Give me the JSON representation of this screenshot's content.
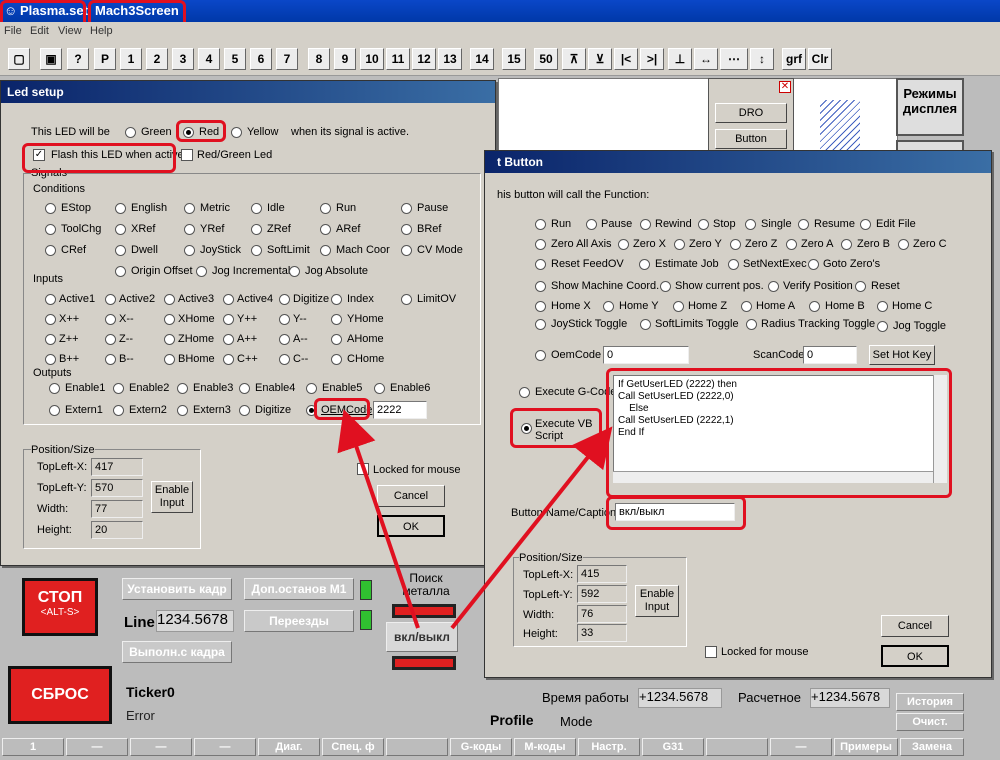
{
  "titlebar": {
    "app": "Plasma.set",
    "screen": "Mach3Screen"
  },
  "menubar": [
    "File",
    "Edit",
    "View",
    "Help"
  ],
  "toolbar": [
    "P",
    "1",
    "2",
    "3",
    "4",
    "5",
    "6",
    "7",
    "8",
    "9",
    "10",
    "11",
    "12",
    "13",
    "14",
    "15",
    "50",
    "grf",
    "Clr"
  ],
  "background": {
    "regimy": "Режимы дисплея",
    "dro_label": "DRO",
    "button_label": "Button",
    "stop": "СТОП",
    "stop_sub": "<ALT-S>",
    "reset": "СБРОС",
    "set_frame": "Установить кадр",
    "run_from": "Выполн.с кадра",
    "m1_stop": "Доп.останов М1",
    "transitions": "Переезды",
    "line_label": "Line",
    "line_value": "1234.5678",
    "search_metal": "Поиск металла",
    "on_off": "вкл/выкл",
    "ticker": "Ticker0",
    "error": "Error",
    "profile": "Profile",
    "mode": "Mode",
    "work_time_label": "Время работы",
    "work_time_value": "+1234.5678",
    "calc_label": "Расчетное",
    "calc_value": "+1234.5678",
    "history": "История",
    "clear": "Очист.",
    "bottom": [
      "1",
      "—",
      "—",
      "—",
      "Диаг.",
      "Спец. ф",
      "",
      "G-коды",
      "М-коды",
      "Настр.",
      "G31",
      "",
      "—",
      "Примеры",
      "Замена"
    ]
  },
  "led_setup": {
    "title": "Led setup",
    "led_will_be": "This LED will be",
    "green": "Green",
    "red": "Red",
    "yellow": "Yellow",
    "when_active": "when its signal is active.",
    "flash": "Flash this LED when active",
    "red_green": "Red/Green Led",
    "signals": "Signals",
    "conditions": "Conditions",
    "cond_rows": [
      [
        "EStop",
        "English",
        "Metric",
        "Idle",
        "Run",
        "Pause"
      ],
      [
        "ToolChg",
        "XRef",
        "YRef",
        "ZRef",
        "ARef",
        "BRef"
      ],
      [
        "CRef",
        "Dwell",
        "JoyStick",
        "SoftLimit",
        "Mach Coor",
        "CV Mode"
      ]
    ],
    "cond_row4": [
      "Origin Offset",
      "Jog Incremental",
      "Jog Absolute"
    ],
    "inputs": "Inputs",
    "input_rows": [
      [
        "Active1",
        "Active2",
        "Active3",
        "Active4",
        "Digitize",
        "Index",
        "LimitOV"
      ],
      [
        "X++",
        "X--",
        "XHome",
        "Y++",
        "Y--",
        "YHome"
      ],
      [
        "Z++",
        "Z--",
        "ZHome",
        "A++",
        "A--",
        "AHome"
      ],
      [
        "B++",
        "B--",
        "BHome",
        "C++",
        "C--",
        "CHome"
      ]
    ],
    "outputs": "Outputs",
    "output_row1": [
      "Enable1",
      "Enable2",
      "Enable3",
      "Enable4",
      "Enable5",
      "Enable6"
    ],
    "output_row2": [
      "Extern1",
      "Extern2",
      "Extern3",
      "Digitize",
      "OEMCode"
    ],
    "oem_value": "2222",
    "position_size": "Position/Size",
    "topleft_x_label": "TopLeft-X:",
    "topleft_x": "417",
    "topleft_y_label": "TopLeft-Y:",
    "topleft_y": "570",
    "width_label": "Width:",
    "width": "77",
    "height_label": "Height:",
    "height": "20",
    "enable_input": "Enable Input",
    "locked": "Locked for mouse",
    "cancel": "Cancel",
    "ok": "OK"
  },
  "button_setup": {
    "title": "t Button",
    "call_fn": "his button will call the Function:",
    "fn_rows": [
      [
        "Run",
        "Pause",
        "Rewind",
        "Stop",
        "Single",
        "Resume",
        "Edit File"
      ],
      [
        "Zero All Axis",
        "Zero X",
        "Zero Y",
        "Zero Z",
        "Zero A",
        "Zero B",
        "Zero C"
      ],
      [
        "Reset FeedOV",
        "Estimate Job",
        "SetNextExec",
        "Goto Zero's"
      ],
      [
        "Show Machine Coord.",
        "Show current pos.",
        "Verify Position",
        "Reset"
      ],
      [
        "Home X",
        "Home Y",
        "Home Z",
        "Home A",
        "Home B",
        "Home C"
      ],
      [
        "JoyStick Toggle",
        "SoftLimits Toggle",
        "Radius Tracking Toggle",
        "Jog Toggle"
      ]
    ],
    "oem_code": "OemCode",
    "oem_value": "0",
    "scan_code": "ScanCode",
    "scan_value": "0",
    "set_hot_key": "Set Hot Key",
    "exec_gcode": "Execute G-Code",
    "exec_vb": "Execute VB Script",
    "vb_script": "If GetUserLED (2222) then\nCall SetUserLED (2222,0)\n    Else\nCall SetUserLED (2222,1)\nEnd If",
    "caption_label": "Button Name/Caption",
    "caption_value": "вкл/выкл",
    "position_size": "Position/Size",
    "topleft_x_label": "TopLeft-X:",
    "topleft_x": "415",
    "topleft_y_label": "TopLeft-Y:",
    "topleft_y": "592",
    "width_label": "Width:",
    "width": "76",
    "height_label": "Height:",
    "height": "33",
    "enable_input": "Enable Input",
    "locked": "Locked for mouse",
    "cancel": "Cancel",
    "ok": "OK"
  },
  "colors": {
    "highlight": "#e01020",
    "titlebar": "#0a47c8",
    "dialog": "#d4d0c8"
  }
}
